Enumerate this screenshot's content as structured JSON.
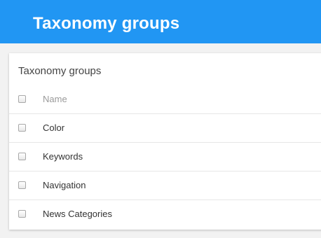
{
  "header": {
    "title": "Taxonomy groups"
  },
  "card": {
    "title": "Taxonomy groups",
    "columns": {
      "name": "Name"
    },
    "rows": [
      {
        "name": "Color"
      },
      {
        "name": "Keywords"
      },
      {
        "name": "Navigation"
      },
      {
        "name": "News Categories"
      }
    ]
  },
  "colors": {
    "header_bg": "#2196f3",
    "page_bg": "#f2f2f2",
    "card_bg": "#ffffff"
  }
}
